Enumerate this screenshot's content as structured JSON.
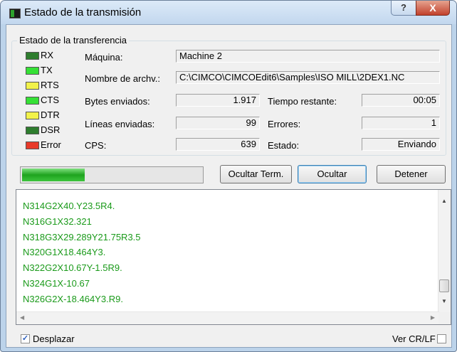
{
  "window": {
    "title": "Estado de la transmisión",
    "help_label": "?",
    "close_label": "X"
  },
  "group": {
    "title": "Estado de la transferencia"
  },
  "leds": [
    {
      "label": "RX",
      "color": "#2e7d2e"
    },
    {
      "label": "TX",
      "color": "#35e035"
    },
    {
      "label": "RTS",
      "color": "#f2f24a"
    },
    {
      "label": "CTS",
      "color": "#35e035"
    },
    {
      "label": "DTR",
      "color": "#f2f24a"
    },
    {
      "label": "DSR",
      "color": "#2e7d2e"
    },
    {
      "label": "Error",
      "color": "#e83a2a"
    }
  ],
  "fields": {
    "machine": {
      "label": "Máquina:",
      "value": "Machine 2"
    },
    "filename": {
      "label": "Nombre de archv.:",
      "value": "C:\\CIMCO\\CIMCOEdit6\\Samples\\ISO MILL\\2DEX1.NC"
    },
    "bytes": {
      "label": "Bytes enviados:",
      "value": "1.917"
    },
    "lines": {
      "label": "Líneas enviadas:",
      "value": "99"
    },
    "cps": {
      "label": "CPS:",
      "value": "639"
    },
    "time_left": {
      "label": "Tiempo restante:",
      "value": "00:05"
    },
    "errors": {
      "label": "Errores:",
      "value": "1"
    },
    "state": {
      "label": "Estado:",
      "value": "Enviando"
    }
  },
  "progress": {
    "fraction": 0.35
  },
  "buttons": {
    "hide_term": "Ocultar Term.",
    "hide": "Ocultar",
    "stop": "Detener"
  },
  "terminal": {
    "lines": [
      "N314G2X40.Y23.5R4.",
      "N316G1X32.321",
      "N318G3X29.289Y21.75R3.5",
      "N320G1X18.464Y3.",
      "N322G2X10.67Y-1.5R9.",
      "N324G1X-10.67",
      "N326G2X-18.464Y3.R9."
    ]
  },
  "scroll_checkbox": {
    "label": "Desplazar",
    "checked": true
  },
  "crlf_checkbox": {
    "label": "Ver CR/LF",
    "checked": false
  },
  "icons": [
    "app-icon",
    "help-icon",
    "close-icon"
  ]
}
